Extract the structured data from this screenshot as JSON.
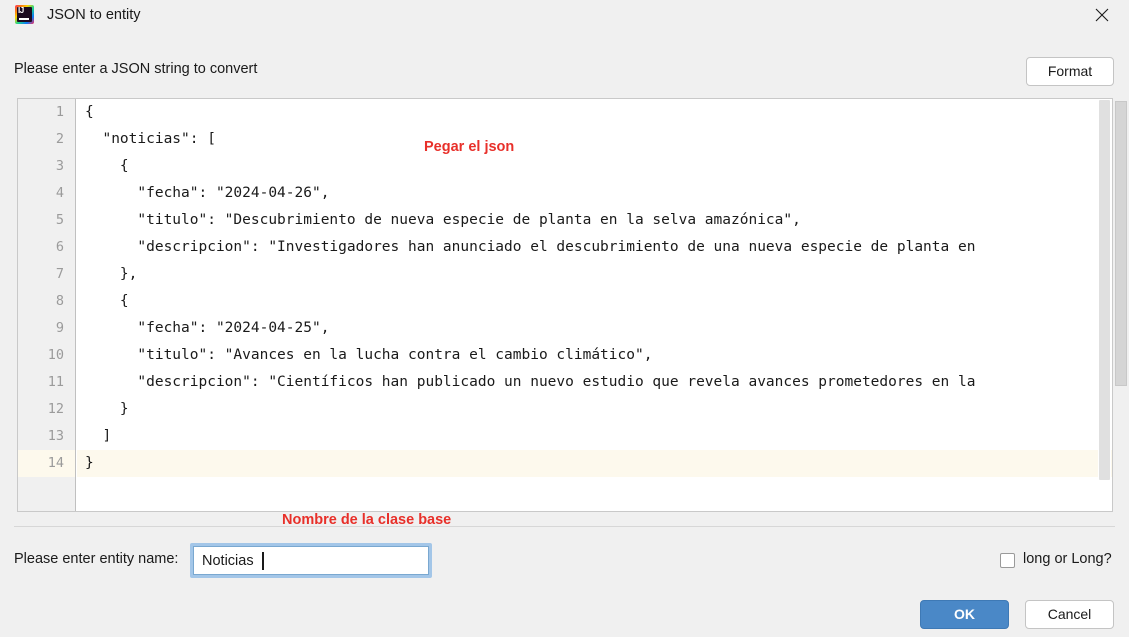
{
  "window": {
    "title": "JSON to entity",
    "app_icon": "intellij-idea-icon",
    "close_icon": "close-icon"
  },
  "header": {
    "prompt": "Please enter a JSON string to convert",
    "format_label": "Format"
  },
  "editor": {
    "line_numbers": [
      "1",
      "2",
      "3",
      "4",
      "5",
      "6",
      "7",
      "8",
      "9",
      "10",
      "11",
      "12",
      "13",
      "14"
    ],
    "active_line": 14,
    "lines": [
      "{",
      "  \"noticias\": [",
      "    {",
      "      \"fecha\": \"2024-04-26\",",
      "      \"titulo\": \"Descubrimiento de nueva especie de planta en la selva amazónica\",",
      "      \"descripcion\": \"Investigadores han anunciado el descubrimiento de una nueva especie de planta en",
      "    },",
      "    {",
      "      \"fecha\": \"2024-04-25\",",
      "      \"titulo\": \"Avances en la lucha contra el cambio climático\",",
      "      \"descripcion\": \"Científicos han publicado un nuevo estudio que revela avances prometedores en la",
      "    }",
      "  ]",
      "}"
    ]
  },
  "footer": {
    "entity_label": "Please enter entity name:",
    "entity_value": "Noticias",
    "entity_placeholder": "",
    "long_checkbox_label": "long or Long?",
    "long_checkbox_checked": false,
    "ok_label": "OK",
    "cancel_label": "Cancel"
  },
  "annotations": [
    {
      "text": "Pegar el json",
      "color": "#e8302a"
    },
    {
      "text": "Nombre de la clase base",
      "color": "#e8302a"
    }
  ]
}
